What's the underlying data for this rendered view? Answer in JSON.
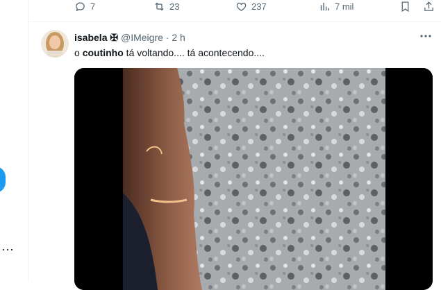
{
  "actions": {
    "replies": "7",
    "retweets": "23",
    "likes": "237",
    "views": "7 mil"
  },
  "tweet": {
    "author_name": "isabela ✠",
    "handle": "@IMeigre",
    "separator": "·",
    "time": "2 h",
    "text_prefix": "o ",
    "text_bold": "coutinho",
    "text_suffix": " tá voltando.... tá acontecendo...."
  },
  "sidebar": {
    "more_label": "···"
  },
  "colors": {
    "accent": "#1d9bf0",
    "secondary_text": "#536471",
    "primary_text": "#0f1419"
  }
}
